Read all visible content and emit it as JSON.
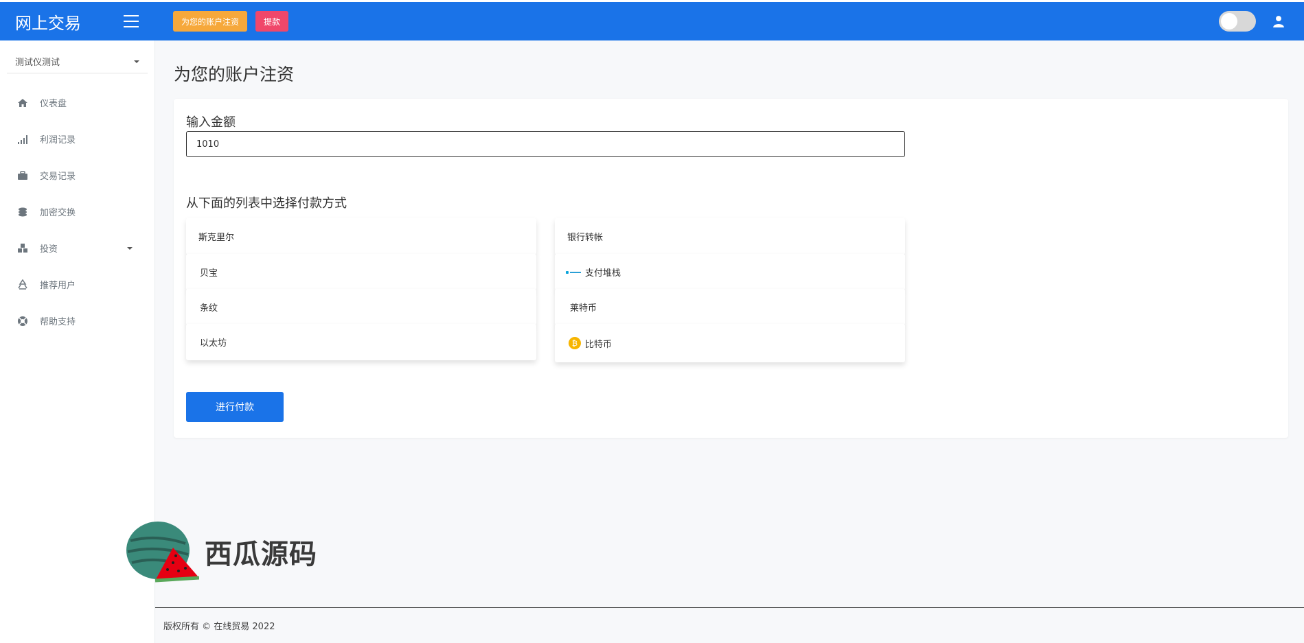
{
  "brand": {
    "title": "网上交易"
  },
  "header": {
    "deposit_label": "为您的账户注资",
    "withdraw_label": "提款"
  },
  "sidebar": {
    "account_name": "测试仪测试",
    "items": [
      {
        "label": "仪表盘",
        "icon": "home-icon"
      },
      {
        "label": "利润记录",
        "icon": "signal-bars-icon"
      },
      {
        "label": "交易记录",
        "icon": "briefcase-icon"
      },
      {
        "label": "加密交换",
        "icon": "coins-icon"
      },
      {
        "label": "投资",
        "icon": "cubes-icon"
      },
      {
        "label": "推荐用户",
        "icon": "recycle-icon"
      },
      {
        "label": "帮助支持",
        "icon": "lifebuoy-icon"
      }
    ]
  },
  "main": {
    "page_title": "为您的账户注资",
    "amount_label": "输入金额",
    "amount_value": "1010",
    "method_label": "从下面的列表中选择付款方式",
    "methods_left": [
      "斯克里尔",
      "贝宝",
      "条纹",
      "以太坊"
    ],
    "methods_right": [
      "银行转帐",
      "支付堆栈",
      "莱特币",
      "比特币"
    ],
    "submit_label": "进行付款"
  },
  "watermark": {
    "text": "西瓜源码"
  },
  "footer": {
    "copyright": "版权所有 © 在线贸易 2022"
  },
  "colors": {
    "primary": "#1a73e8",
    "deposit_button": "#f6a83b",
    "withdraw_button": "#f0476a",
    "bitcoin": "#f7b500"
  }
}
